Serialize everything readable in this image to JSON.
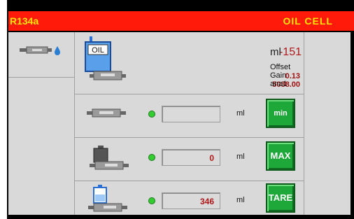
{
  "header": {
    "refrigerant": "R134a",
    "title": "OIL  CELL"
  },
  "top": {
    "tank_label": "OIL",
    "value": "-151",
    "unit": "ml",
    "offset_value": "0.13",
    "gain_value": "5038.00",
    "labels": {
      "offset": "Offset",
      "gain": "Gain",
      "channel": "ana1"
    }
  },
  "rows": [
    {
      "field_value": "",
      "unit": "ml",
      "button": "min"
    },
    {
      "field_value": "0",
      "unit": "ml",
      "button": "MAX"
    },
    {
      "field_value": "346",
      "unit": "ml",
      "button": "TARE"
    }
  ],
  "colors": {
    "header_bg": "#ff1a0a",
    "header_text": "#ffe600",
    "button_green": "#1fa83a",
    "value_red": "#b01818",
    "led_green": "#33cc33"
  }
}
